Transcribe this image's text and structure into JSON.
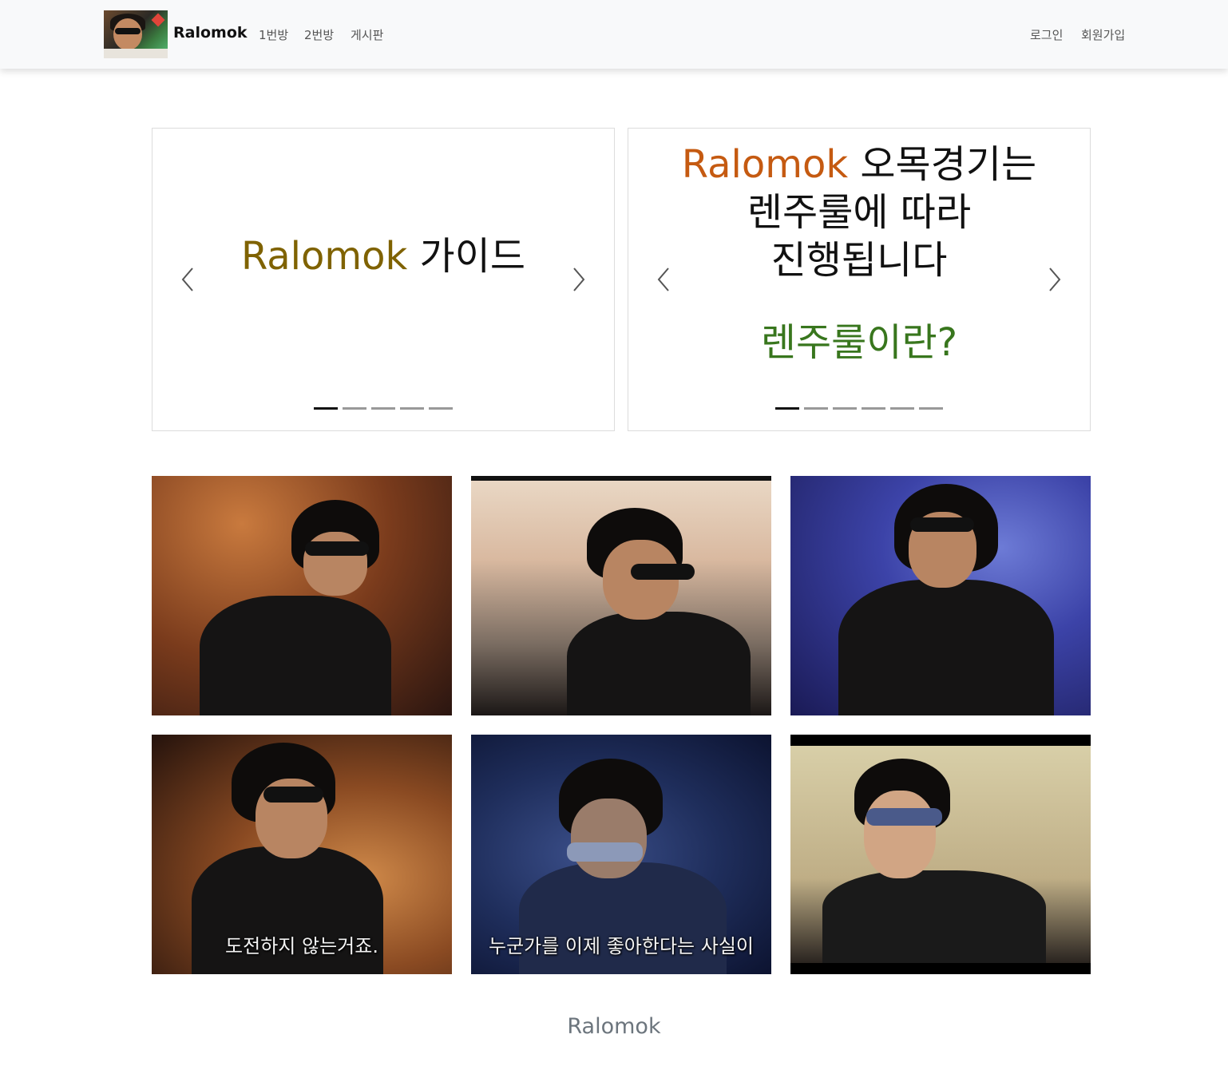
{
  "navbar": {
    "brand": "Ralomok",
    "links": {
      "room1": "1번방",
      "room2": "2번방",
      "board": "게시판",
      "login": "로그인",
      "signup": "회원가입"
    }
  },
  "carousel_left": {
    "title_accent": "Ralomok",
    "title_rest": " 가이드",
    "slide_count": 5,
    "active_index": 0
  },
  "carousel_right": {
    "line1_accent": "Ralomok",
    "line1_rest": " 오목경기는",
    "line2": "렌주룰에 따라",
    "line3": "진행됩니다",
    "question": "렌주룰이란?",
    "slide_count": 6,
    "active_index": 0
  },
  "gallery": {
    "captions": {
      "t4": "도전하지 않는거죠.",
      "t5": "누군가를 이제 좋아한다는 사실이"
    }
  },
  "footer": {
    "text": "Ralomok"
  },
  "colors": {
    "navbar_bg": "#f8f9fa",
    "left_accent": "#7f6200",
    "right_accent": "#c55a11",
    "question_green": "#38761d",
    "footer_text": "#6c757d"
  }
}
